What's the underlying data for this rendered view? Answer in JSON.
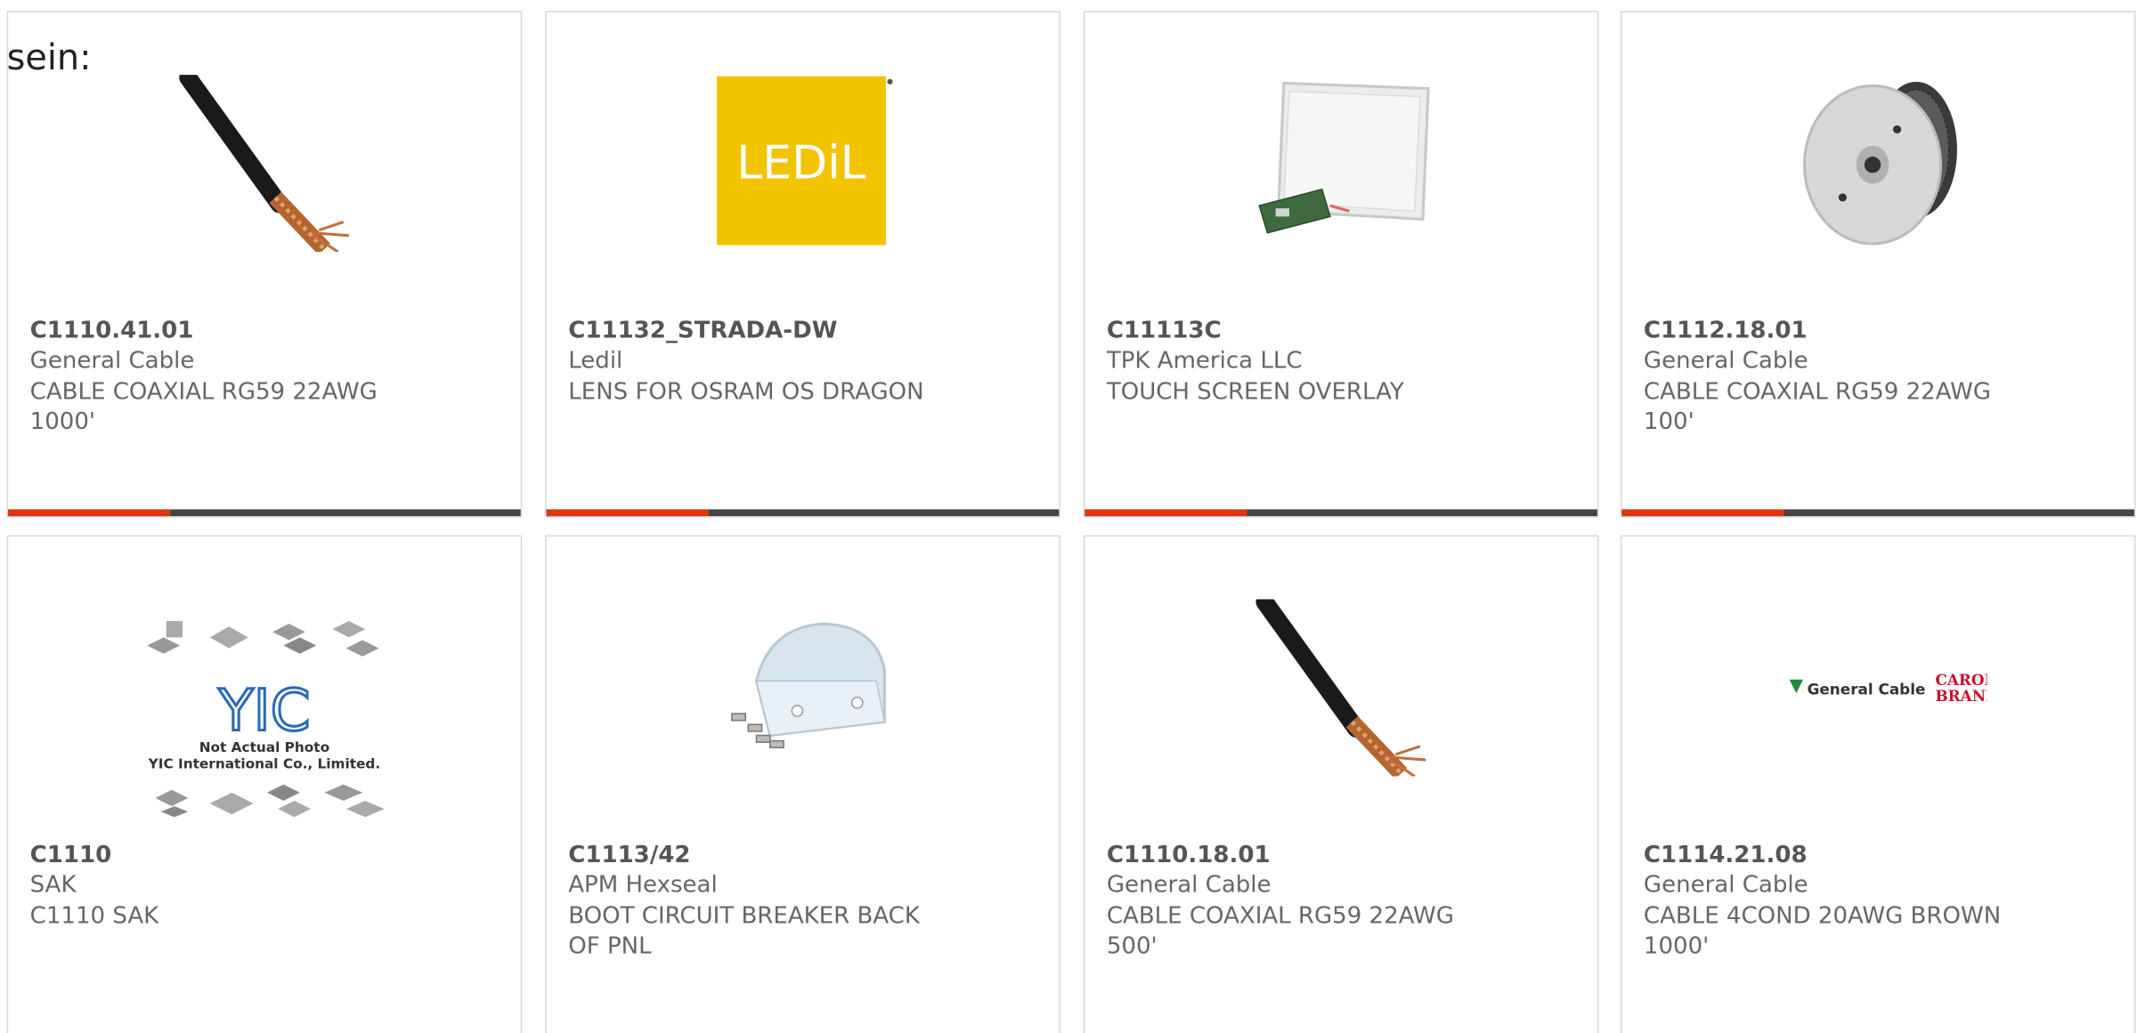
{
  "lead_text": "sein:",
  "colors": {
    "accent": "#e0360f",
    "bar": "#444444",
    "border": "#d8d8d8",
    "text": "#666666"
  },
  "products": [
    {
      "part_no": "C1110.41.01",
      "maker": "General Cable",
      "desc": "CABLE COAXIAL RG59 22AWG 1000'",
      "image": "coax-cable-icon"
    },
    {
      "part_no": "C11132_STRADA-DW",
      "maker": "Ledil",
      "desc": "LENS FOR OSRAM OS DRAGON",
      "image": "ledil-logo-icon",
      "logo_text": "LEDiL"
    },
    {
      "part_no": "C11113C",
      "maker": "TPK America LLC",
      "desc": "TOUCH SCREEN OVERLAY",
      "image": "touch-screen-icon"
    },
    {
      "part_no": "C1112.18.01",
      "maker": "General Cable",
      "desc": "CABLE COAXIAL RG59 22AWG 100'",
      "image": "cable-spool-icon"
    },
    {
      "part_no": "C1110",
      "maker": "SAK",
      "desc": "C1110 SAK",
      "image": "yic-placeholder-icon",
      "logo_text": "YIC",
      "photo_note": "Not Actual Photo",
      "photo_company": "YIC International Co., Limited."
    },
    {
      "part_no": "C1113/42",
      "maker": "APM Hexseal",
      "desc": "BOOT CIRCUIT BREAKER BACK OF PNL",
      "image": "boot-icon"
    },
    {
      "part_no": "C1110.18.01",
      "maker": "General Cable",
      "desc": "CABLE COAXIAL RG59 22AWG 500'",
      "image": "coax-cable-icon"
    },
    {
      "part_no": "C1114.21.08",
      "maker": "General Cable",
      "desc": "CABLE 4COND 20AWG BROWN 1000'",
      "image": "general-cable-logo-icon",
      "logo_text": "General Cable",
      "logo_text2": "CAROL",
      "logo_text3": "BRAND"
    }
  ]
}
